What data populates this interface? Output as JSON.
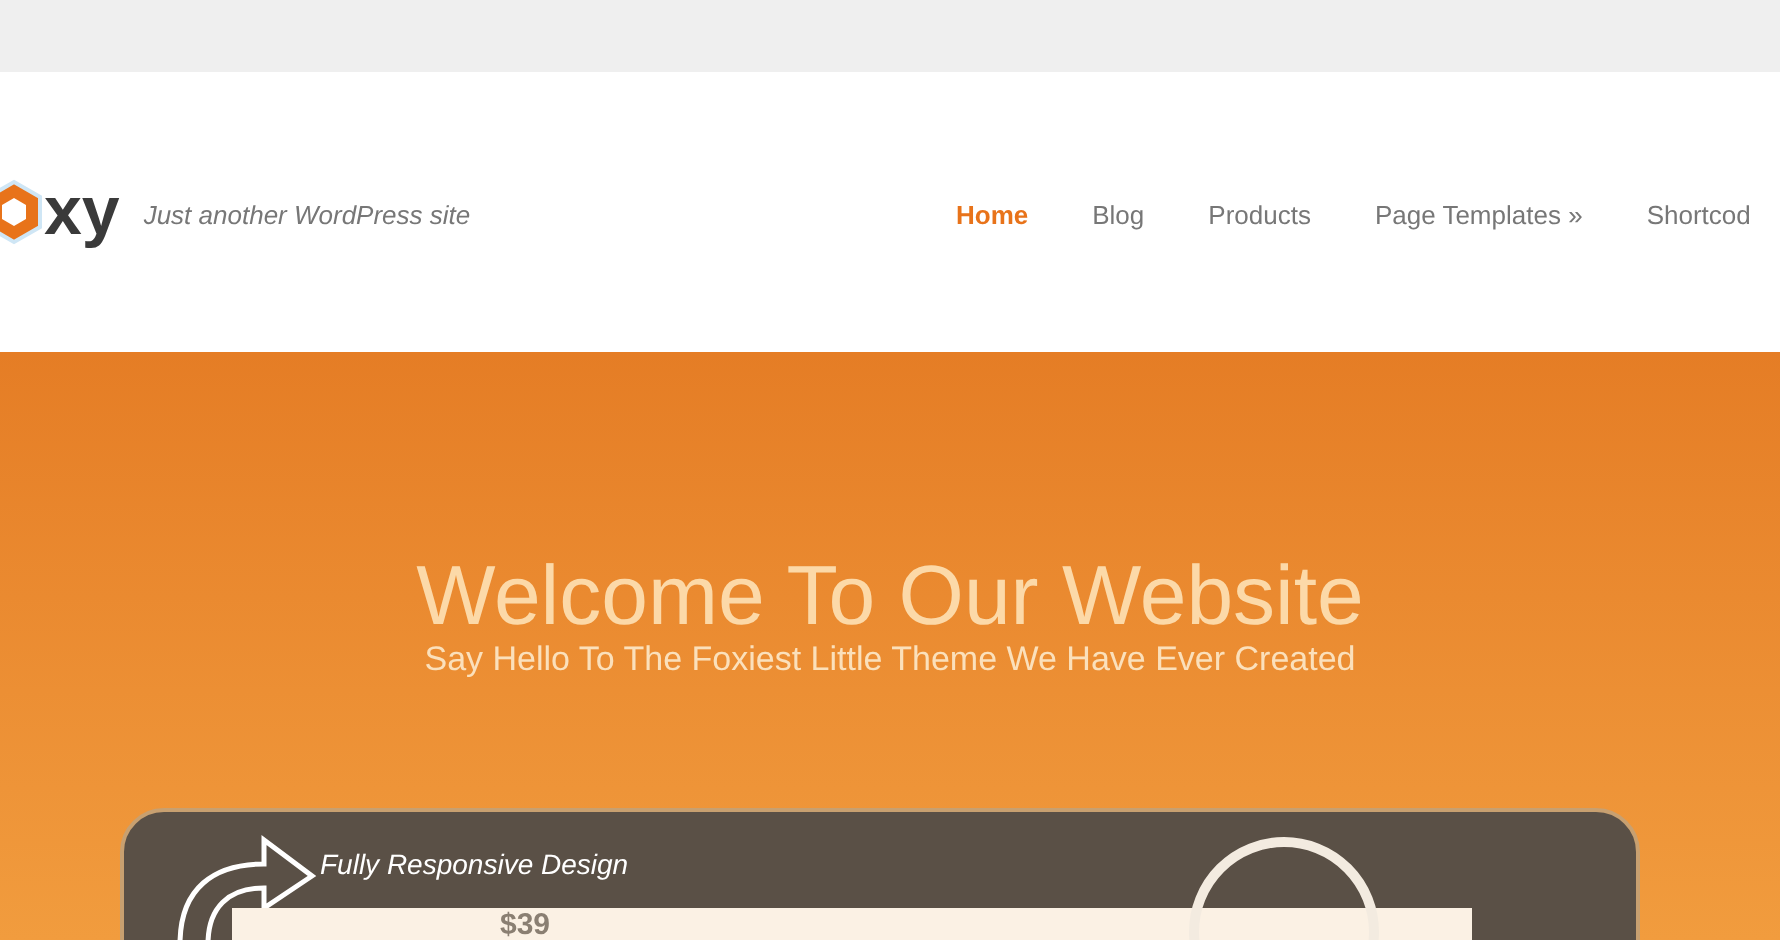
{
  "header": {
    "logo_text": "xy",
    "tagline": "Just another WordPress site"
  },
  "nav": [
    {
      "label": "Home",
      "selected": true
    },
    {
      "label": "Blog",
      "selected": false
    },
    {
      "label": "Products",
      "selected": false
    },
    {
      "label": "Page Templates »",
      "selected": false
    },
    {
      "label": "Shortcod",
      "selected": false
    }
  ],
  "hero": {
    "title": "Welcome To Our Website",
    "subtitle": "Say Hello To The Foxiest Little Theme We Have Ever Created",
    "slide_caption": "Fully Responsive Design",
    "price": "$39"
  }
}
